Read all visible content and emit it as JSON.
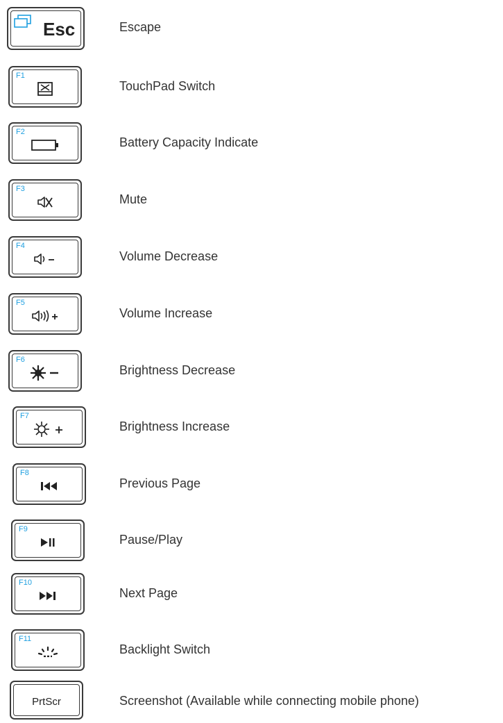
{
  "keys": [
    {
      "name": "esc",
      "key_label": "Esc",
      "fn": "",
      "icon": "window-switch-icon",
      "desc": "Escape"
    },
    {
      "name": "f1",
      "fn": "F1",
      "icon": "touchpad-icon",
      "desc": "TouchPad Switch"
    },
    {
      "name": "f2",
      "fn": "F2",
      "icon": "battery-icon",
      "desc": "Battery Capacity Indicate"
    },
    {
      "name": "f3",
      "fn": "F3",
      "icon": "mute-icon",
      "desc": "Mute"
    },
    {
      "name": "f4",
      "fn": "F4",
      "icon": "volume-down-icon",
      "desc": "Volume Decrease"
    },
    {
      "name": "f5",
      "fn": "F5",
      "icon": "volume-up-icon",
      "desc": "Volume Increase"
    },
    {
      "name": "f6",
      "fn": "F6",
      "icon": "brightness-down-icon",
      "desc": "Brightness Decrease"
    },
    {
      "name": "f7",
      "fn": "F7",
      "icon": "brightness-up-icon",
      "desc": "Brightness Increase"
    },
    {
      "name": "f8",
      "fn": "F8",
      "icon": "previous-track-icon",
      "desc": "Previous Page"
    },
    {
      "name": "f9",
      "fn": "F9",
      "icon": "play-pause-icon",
      "desc": "Pause/Play"
    },
    {
      "name": "f10",
      "fn": "F10",
      "icon": "next-track-icon",
      "desc": "Next Page"
    },
    {
      "name": "f11",
      "fn": "F11",
      "icon": "backlight-icon",
      "desc": "Backlight Switch"
    },
    {
      "name": "prtscr",
      "key_label": "PrtScr",
      "fn": "",
      "icon": "",
      "desc": "Screenshot  (Available while connecting mobile phone)"
    }
  ],
  "colors": {
    "fn_label": "#1e9fe0",
    "key_border": "#3a3a3a",
    "text": "#333333"
  }
}
